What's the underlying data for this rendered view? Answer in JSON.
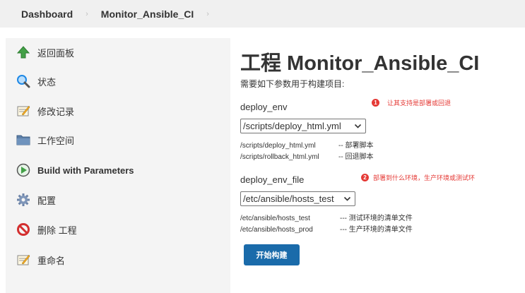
{
  "breadcrumb": {
    "items": [
      "Dashboard",
      "Monitor_Ansible_CI"
    ],
    "separator": "›"
  },
  "sidebar": {
    "items": [
      {
        "label": "返回面板",
        "icon": "up-arrow-icon"
      },
      {
        "label": "状态",
        "icon": "magnifier-icon"
      },
      {
        "label": "修改记录",
        "icon": "notepad-icon"
      },
      {
        "label": "工作空间",
        "icon": "folder-icon"
      },
      {
        "label": "Build with Parameters",
        "icon": "clock-play-icon"
      },
      {
        "label": "配置",
        "icon": "gear-icon"
      },
      {
        "label": "删除 工程",
        "icon": "no-entry-icon"
      },
      {
        "label": "重命名",
        "icon": "notepad-icon"
      }
    ]
  },
  "main": {
    "title": "工程 Monitor_Ansible_CI",
    "subtitle": "需要如下参数用于构建项目:",
    "params": [
      {
        "name": "deploy_env",
        "selected": "/scripts/deploy_html.yml",
        "desc": [
          {
            "key": "/scripts/deploy_html.yml",
            "val": "-- 部署脚本"
          },
          {
            "key": "/scripts/rollback_html.yml",
            "val": "-- 回退脚本"
          }
        ],
        "note": {
          "num": "1",
          "text": "让其支持是部署或回退"
        }
      },
      {
        "name": "deploy_env_file",
        "selected": "/etc/ansible/hosts_test",
        "desc": [
          {
            "key": "/etc/ansible/hosts_test",
            "val": "--- 测试环境的清单文件"
          },
          {
            "key": "/etc/ansible/hosts_prod",
            "val": "--- 生产环境的清单文件"
          }
        ],
        "note": {
          "num": "2",
          "text": "部署到什么环境，生产环境或测试环"
        }
      }
    ],
    "build_button": "开始构建"
  },
  "colors": {
    "accent": "#1a6baa",
    "annotation": "#e53935",
    "sidebar_bg": "#f4f4f4",
    "breadcrumb_bg": "#f0f0f0"
  }
}
